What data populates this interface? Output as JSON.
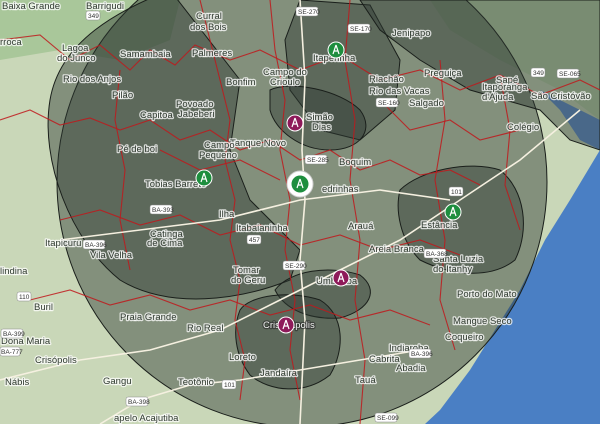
{
  "map": {
    "colors": {
      "land": "#c9d7b8",
      "water": "#4a7fc4",
      "coverage": "#2f3a32",
      "border": "#c0191c",
      "tower_green": "#1e8e3e",
      "tower_purple": "#8e1a5a"
    },
    "places": [
      {
        "id": "baixa-grande",
        "text": "Baixa Grande"
      },
      {
        "id": "barrigudi",
        "text": "Barrigudi"
      },
      {
        "id": "curral-dos-bois-1",
        "text": "Curral"
      },
      {
        "id": "curral-dos-bois-2",
        "text": "dos Bois"
      },
      {
        "id": "lagoa-1",
        "text": "Lagoa"
      },
      {
        "id": "lagoa-2",
        "text": "do Junco"
      },
      {
        "id": "arroca",
        "text": "rroca"
      },
      {
        "id": "samambaia",
        "text": "Samambaia"
      },
      {
        "id": "palmeres",
        "text": "Palmeres"
      },
      {
        "id": "rio-dos-anjos",
        "text": "Rio dos Anjos"
      },
      {
        "id": "itaperinha",
        "text": "Itaperinha"
      },
      {
        "id": "jenipapo",
        "text": "Jenipapo"
      },
      {
        "id": "campo-1",
        "text": "Campo do"
      },
      {
        "id": "campo-2",
        "text": "Crioulo"
      },
      {
        "id": "pilao",
        "text": "Pilão"
      },
      {
        "id": "bonfim",
        "text": "Bonfim"
      },
      {
        "id": "riachao",
        "text": "Riachão"
      },
      {
        "id": "rio-das-vacas",
        "text": "Rio das Vacas"
      },
      {
        "id": "preguica",
        "text": "Preguiça"
      },
      {
        "id": "sape",
        "text": "Sapé"
      },
      {
        "id": "itaporanga-1",
        "text": "Itaporanga"
      },
      {
        "id": "itaporanga-2",
        "text": "d'Ajuda"
      },
      {
        "id": "sao-cristovao",
        "text": "São Cristóvão"
      },
      {
        "id": "capitoa",
        "text": "Capitoa"
      },
      {
        "id": "povoado-1",
        "text": "Povoado"
      },
      {
        "id": "povoado-2",
        "text": "Jabeberi"
      },
      {
        "id": "salgado",
        "text": "Salgado"
      },
      {
        "id": "colegio",
        "text": "Colégio"
      },
      {
        "id": "simao-1",
        "text": "Simão"
      },
      {
        "id": "simao-2",
        "text": "Dias"
      },
      {
        "id": "tanque-novo",
        "text": "Tanque Novo"
      },
      {
        "id": "campo-pequeno-1",
        "text": "Campo"
      },
      {
        "id": "campo-pequeno-2",
        "text": "Pequeno"
      },
      {
        "id": "pe-de-boi",
        "text": "Pé de boi"
      },
      {
        "id": "boquim",
        "text": "Boquim"
      },
      {
        "id": "tobias-barreto",
        "text": "Tobias Barreto"
      },
      {
        "id": "pedrinhas",
        "text": "edrinhas"
      },
      {
        "id": "ilha",
        "text": "Ilha"
      },
      {
        "id": "estancia",
        "text": "Estância"
      },
      {
        "id": "itapicuru",
        "text": "Itapicuru"
      },
      {
        "id": "catinga-1",
        "text": "Catinga"
      },
      {
        "id": "catinga-2",
        "text": "de Cima"
      },
      {
        "id": "itabaianinha",
        "text": "Itabaianinha"
      },
      {
        "id": "araua",
        "text": "Arauá"
      },
      {
        "id": "areia-branca",
        "text": "Areia Branca"
      },
      {
        "id": "vila-velha",
        "text": "Vila Velha"
      },
      {
        "id": "santa-luzia-1",
        "text": "Santa Luzia"
      },
      {
        "id": "santa-luzia-2",
        "text": "do Itanhy"
      },
      {
        "id": "olindina",
        "text": "lindina"
      },
      {
        "id": "tomar-1",
        "text": "Tomar"
      },
      {
        "id": "tomar-2",
        "text": "do Geru"
      },
      {
        "id": "umbauba",
        "text": "Umbaúba"
      },
      {
        "id": "porto-do-mato",
        "text": "Porto do Mato"
      },
      {
        "id": "buril",
        "text": "Buril"
      },
      {
        "id": "praia-grande",
        "text": "Praia Grande"
      },
      {
        "id": "mangue-seco",
        "text": "Mangue Seco"
      },
      {
        "id": "rio-real",
        "text": "Rio Real"
      },
      {
        "id": "cristinapolis",
        "text": "Cristinápolis"
      },
      {
        "id": "dona-maria",
        "text": "Dona Maria"
      },
      {
        "id": "crisopolis",
        "text": "Crisópolis"
      },
      {
        "id": "coqueiro",
        "text": "Coqueiro"
      },
      {
        "id": "loreto",
        "text": "Loreto"
      },
      {
        "id": "indiaroba",
        "text": "Indiaroba"
      },
      {
        "id": "jandaira",
        "text": "Jandaíra"
      },
      {
        "id": "nabis",
        "text": "Nábis"
      },
      {
        "id": "cabrita",
        "text": "Cabrita"
      },
      {
        "id": "gangu",
        "text": "Gangu"
      },
      {
        "id": "teotonio",
        "text": "Teotônio"
      },
      {
        "id": "taua",
        "text": "Tauá"
      },
      {
        "id": "abadia",
        "text": "Abadia"
      },
      {
        "id": "assu",
        "text": "apelo Acajutiba"
      }
    ],
    "shields": [
      {
        "id": "se270",
        "text": "SE-270"
      },
      {
        "id": "se170",
        "text": "SE-170"
      },
      {
        "id": "se160",
        "text": "SE-160"
      },
      {
        "id": "se285",
        "text": "SE-285"
      },
      {
        "id": "se290",
        "text": "SE-290"
      },
      {
        "id": "se065",
        "text": "SE-065"
      },
      {
        "id": "ba393",
        "text": "BA-393"
      },
      {
        "id": "ba396",
        "text": "BA-396"
      },
      {
        "id": "ba368",
        "text": "BA-368"
      },
      {
        "id": "ba399",
        "text": "BA-399"
      },
      {
        "id": "ba398",
        "text": "BA-398"
      },
      {
        "id": "ba777",
        "text": "BA-777"
      },
      {
        "id": "r349",
        "text": "349"
      },
      {
        "id": "r349b",
        "text": "349"
      },
      {
        "id": "r101",
        "text": "101"
      },
      {
        "id": "r101b",
        "text": "101"
      },
      {
        "id": "r110",
        "text": "110"
      },
      {
        "id": "r457",
        "text": "457"
      },
      {
        "id": "se099",
        "text": "SE-099"
      },
      {
        "id": "ba-hi",
        "text": "BA-396"
      }
    ],
    "towers": [
      {
        "id": "tower-itaperinha",
        "color": "green"
      },
      {
        "id": "tower-simao-dias",
        "color": "purple"
      },
      {
        "id": "tower-tobias",
        "color": "green"
      },
      {
        "id": "tower-center",
        "color": "green"
      },
      {
        "id": "tower-estancia",
        "color": "green"
      },
      {
        "id": "tower-umbauba",
        "color": "purple"
      },
      {
        "id": "tower-cristinapolis",
        "color": "purple"
      }
    ]
  }
}
